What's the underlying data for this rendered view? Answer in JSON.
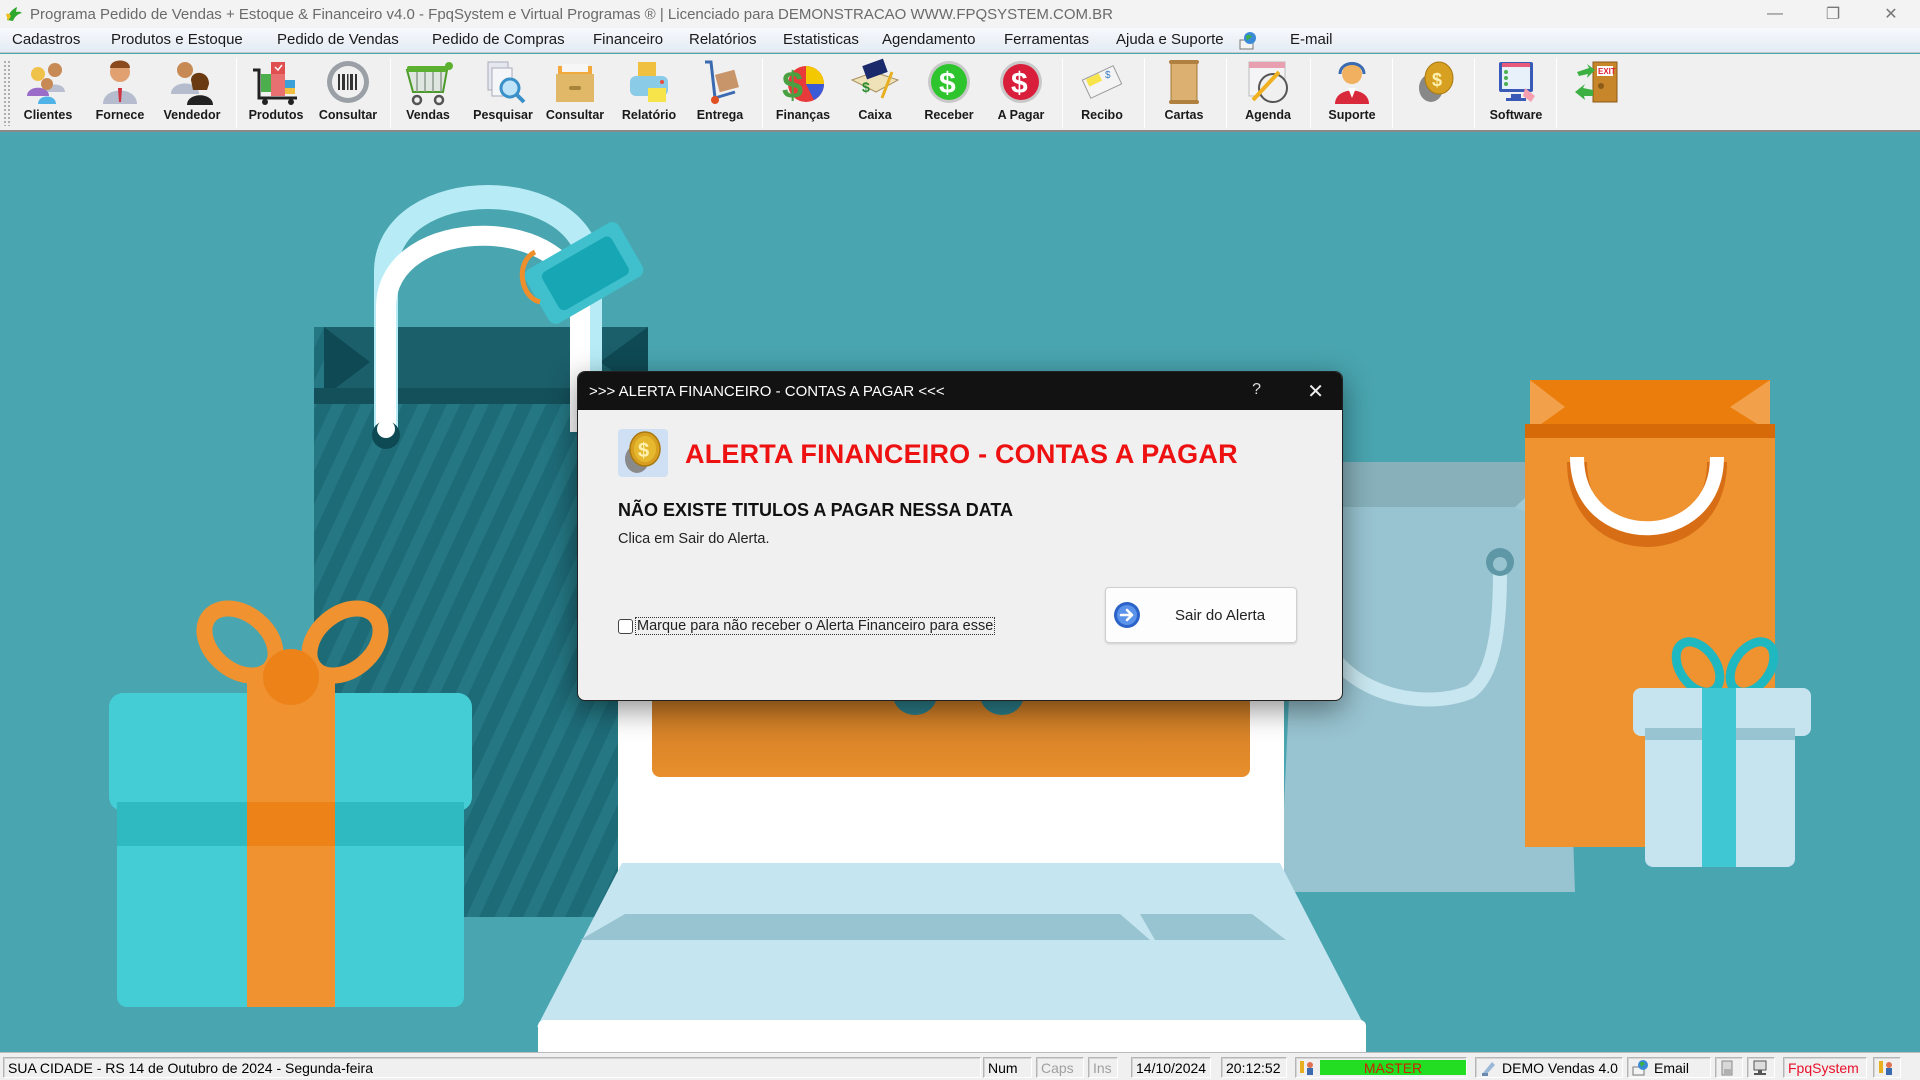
{
  "window": {
    "title": "Programa Pedido de Vendas + Estoque & Financeiro v4.0 - FpqSystem e Virtual Programas ® | Licenciado para  DEMONSTRACAO WWW.FPQSYSTEM.COM.BR",
    "minimize_icon": "minimize-icon",
    "restore_icon": "restore-icon",
    "close_icon": "close-icon"
  },
  "menu": {
    "items": [
      {
        "label": "Cadastros"
      },
      {
        "label": "Produtos e Estoque"
      },
      {
        "label": "Pedido de Vendas"
      },
      {
        "label": "Pedido de Compras"
      },
      {
        "label": "Financeiro"
      },
      {
        "label": "Relatórios"
      },
      {
        "label": "Estatisticas"
      },
      {
        "label": "Agendamento"
      },
      {
        "label": "Ferramentas"
      },
      {
        "label": "Ajuda e Suporte"
      },
      {
        "label": "E-mail"
      }
    ]
  },
  "toolbar": {
    "buttons": [
      {
        "label": "Clientes",
        "icon": "clients-icon"
      },
      {
        "label": "Fornece",
        "icon": "supplier-icon"
      },
      {
        "label": "Vendedor",
        "icon": "seller-icon"
      },
      {
        "label": "Produtos",
        "icon": "products-cart-icon"
      },
      {
        "label": "Consultar",
        "icon": "barcode-icon"
      },
      {
        "label": "Vendas",
        "icon": "shopping-cart-icon"
      },
      {
        "label": "Pesquisar",
        "icon": "search-documents-icon"
      },
      {
        "label": "Consultar",
        "icon": "file-box-icon"
      },
      {
        "label": "Relatório",
        "icon": "printer-icon"
      },
      {
        "label": "Entrega",
        "icon": "hand-truck-icon"
      },
      {
        "label": "Finanças",
        "icon": "finance-pie-icon"
      },
      {
        "label": "Caixa",
        "icon": "cash-book-icon"
      },
      {
        "label": "Receber",
        "icon": "receive-dollar-icon"
      },
      {
        "label": "A Pagar",
        "icon": "pay-dollar-icon"
      },
      {
        "label": "Recibo",
        "icon": "receipt-icon"
      },
      {
        "label": "Cartas",
        "icon": "scroll-icon"
      },
      {
        "label": "Agenda",
        "icon": "calendar-clock-icon"
      },
      {
        "label": "Suporte",
        "icon": "support-headset-icon"
      },
      {
        "label": "",
        "icon": "coin-icon"
      },
      {
        "label": "Software",
        "icon": "software-monitor-icon"
      },
      {
        "label": "",
        "icon": "exit-door-icon"
      }
    ]
  },
  "dialog": {
    "title": ">>> ALERTA FINANCEIRO - CONTAS A PAGAR <<<",
    "help_label": "?",
    "heading": "ALERTA FINANCEIRO - CONTAS A PAGAR",
    "message": "NÃO EXISTE TITULOS A PAGAR NESSA DATA",
    "sub_message": "Clica em Sair do Alerta.",
    "checkbox_label": "Marque para não receber o Alerta Financeiro para esse",
    "checkbox_checked": false,
    "exit_button_label": "Sair do Alerta",
    "heading_color": "#ee1111"
  },
  "statusbar": {
    "location_date": "SUA CIDADE - RS 14 de Outubro de 2024 - Segunda-feira",
    "num": "Num",
    "caps": "Caps",
    "ins": "Ins",
    "date": "14/10/2024",
    "time": "20:12:52",
    "user_level": "MASTER",
    "user_level_bg": "#22dd22",
    "user_level_color": "#cc2200",
    "edition": "DEMO Vendas 4.0",
    "email": "Email",
    "brand": "FpqSystem",
    "brand_color": "#e8102a"
  }
}
